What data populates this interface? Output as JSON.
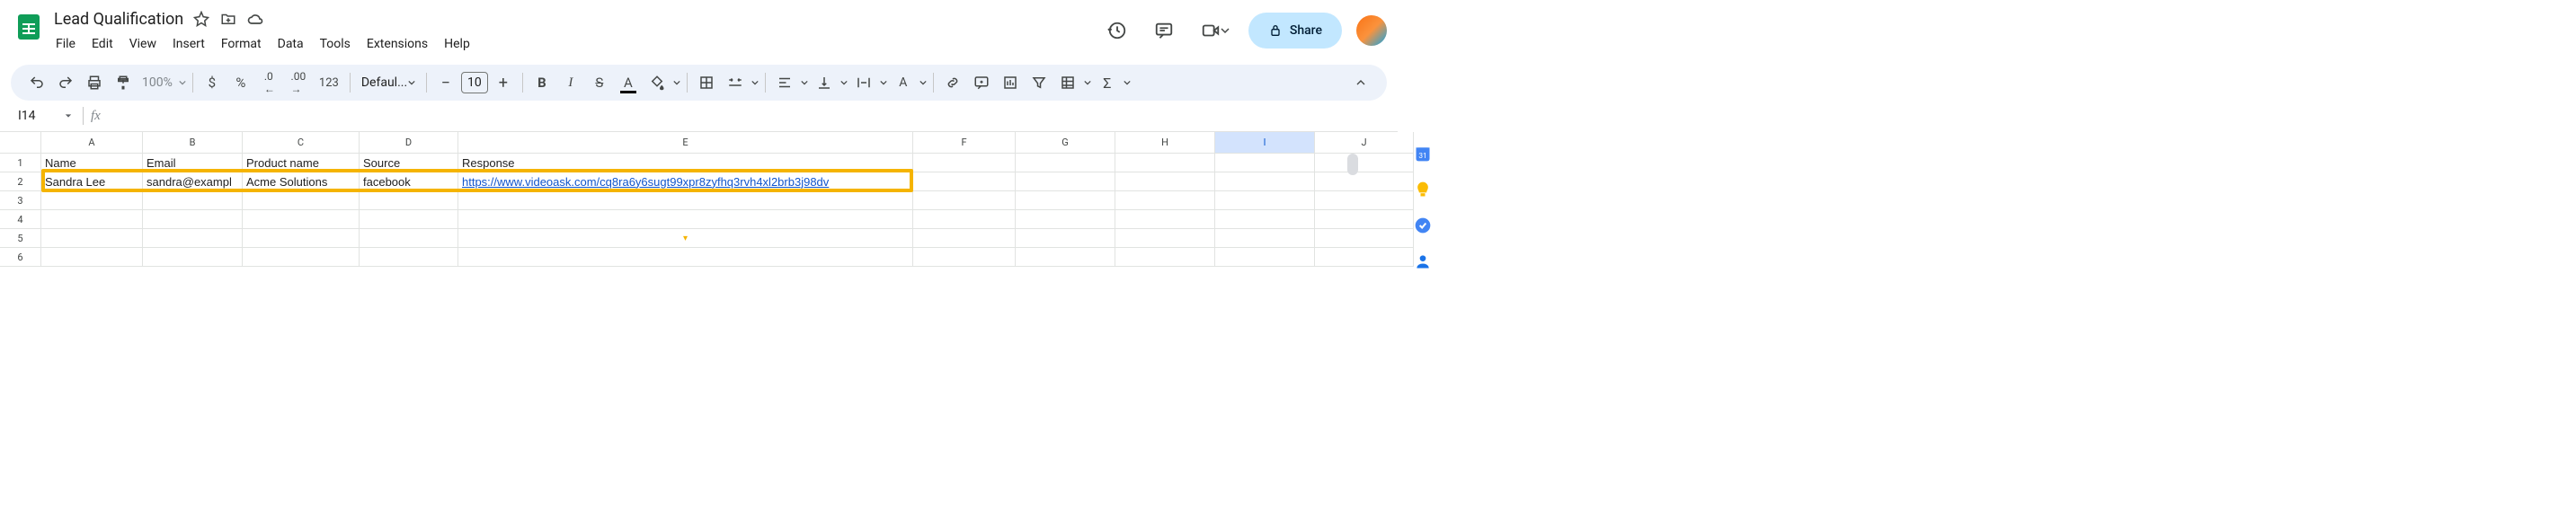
{
  "doc": {
    "title": "Lead Qualification"
  },
  "menus": [
    "File",
    "Edit",
    "View",
    "Insert",
    "Format",
    "Data",
    "Tools",
    "Extensions",
    "Help"
  ],
  "header_buttons": {
    "share": "Share"
  },
  "toolbar": {
    "zoom": "100%",
    "font": "Defaul...",
    "font_size": "10",
    "decimal_123": "123"
  },
  "namebox": {
    "ref": "I14"
  },
  "columns": [
    "A",
    "B",
    "C",
    "D",
    "E",
    "F",
    "G",
    "H",
    "I",
    "J"
  ],
  "selected_column": "I",
  "row_headers": [
    "1",
    "2",
    "3",
    "4",
    "5",
    "6"
  ],
  "rows": [
    {
      "A": "Name",
      "B": "Email",
      "C": "Product name",
      "D": "Source",
      "E": "Response"
    },
    {
      "A": "Sandra Lee",
      "B": "sandra@exampl",
      "C": "Acme Solutions",
      "D": "facebook",
      "E": "https://www.videoask.com/cq8ra6y6sugt99xpr8zyfhq3rvh4xl2brb3j98dv",
      "E_is_link": true
    },
    {},
    {},
    {},
    {}
  ],
  "selected_cell": {
    "row": 14,
    "col": "I"
  },
  "side_panel_calendar_day": "31"
}
